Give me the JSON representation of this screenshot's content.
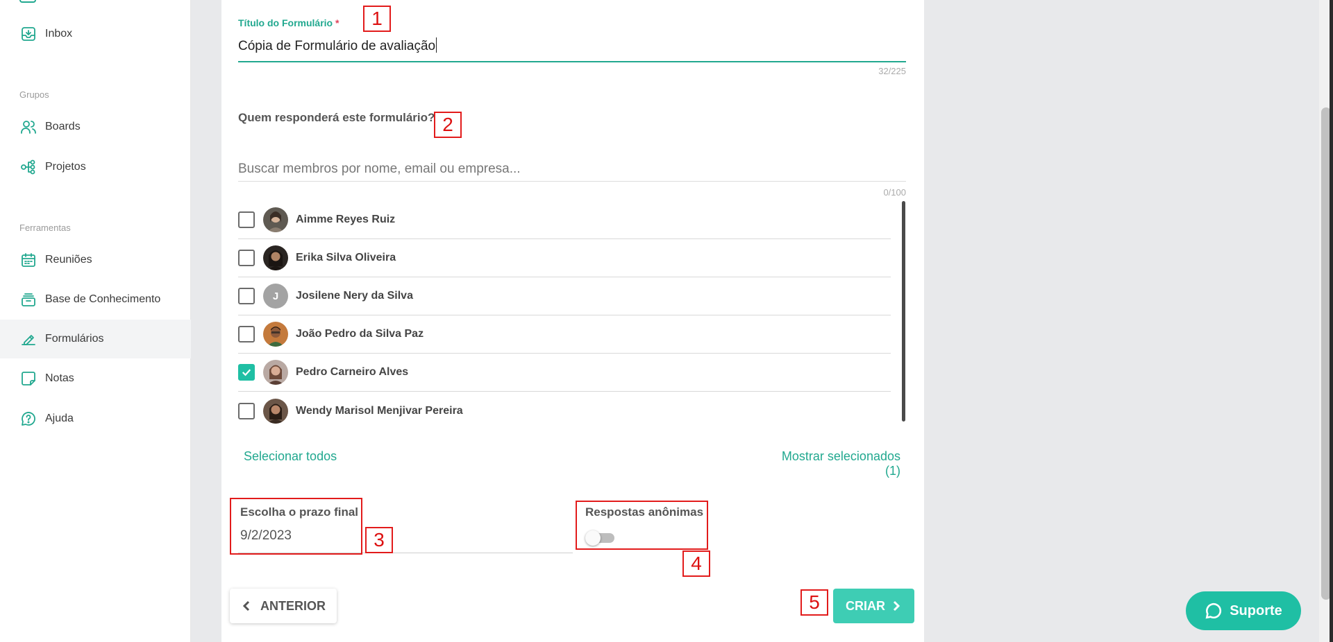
{
  "sidebar": {
    "items": [
      {
        "label": "Inbox",
        "icon": "inbox-icon"
      },
      {
        "label": "Boards",
        "icon": "users-icon"
      },
      {
        "label": "Projetos",
        "icon": "project-tree-icon"
      },
      {
        "label": "Reuniões",
        "icon": "calendar-icon"
      },
      {
        "label": "Base de Conhecimento",
        "icon": "knowledge-base-icon"
      },
      {
        "label": "Formulários",
        "icon": "form-icon"
      },
      {
        "label": "Notas",
        "icon": "note-icon"
      },
      {
        "label": "Ajuda",
        "icon": "help-icon"
      }
    ],
    "sections": {
      "grupos": "Grupos",
      "ferramentas": "Ferramentas"
    },
    "active": "Formulários"
  },
  "form": {
    "title_label": "Título do Formulário",
    "title_required_mark": "*",
    "title_value": "Cópia de Formulário de avaliação",
    "title_counter": "32/225",
    "question_label": "Quem responderá este formulário?",
    "search_placeholder": "Buscar membros por nome, email ou empresa...",
    "search_counter": "0/100",
    "members": [
      {
        "name": "Aimme Reyes Ruiz",
        "checked": false,
        "avatar": "photo"
      },
      {
        "name": "Erika Silva Oliveira",
        "checked": false,
        "avatar": "photo"
      },
      {
        "name": "Josilene Nery da Silva",
        "checked": false,
        "avatar": "J"
      },
      {
        "name": "João Pedro da Silva Paz",
        "checked": false,
        "avatar": "photo"
      },
      {
        "name": "Pedro Carneiro Alves",
        "checked": true,
        "avatar": "photo"
      },
      {
        "name": "Wendy Marisol Menjivar Pereira",
        "checked": false,
        "avatar": "photo"
      }
    ],
    "select_all": "Selecionar todos",
    "show_selected": "Mostrar selecionados (1)",
    "deadline_label": "Escolha o prazo final",
    "deadline_value": "9/2/2023",
    "anonymous_label": "Respostas anônimas",
    "anonymous_enabled": false,
    "prev_button": "ANTERIOR",
    "create_button": "CRIAR"
  },
  "annotations": [
    "1",
    "2",
    "3",
    "4",
    "5"
  ],
  "support_button": "Suporte",
  "colors": {
    "accent": "#21a88f",
    "button": "#3ecdb4",
    "annotation": "#e21b1b"
  }
}
